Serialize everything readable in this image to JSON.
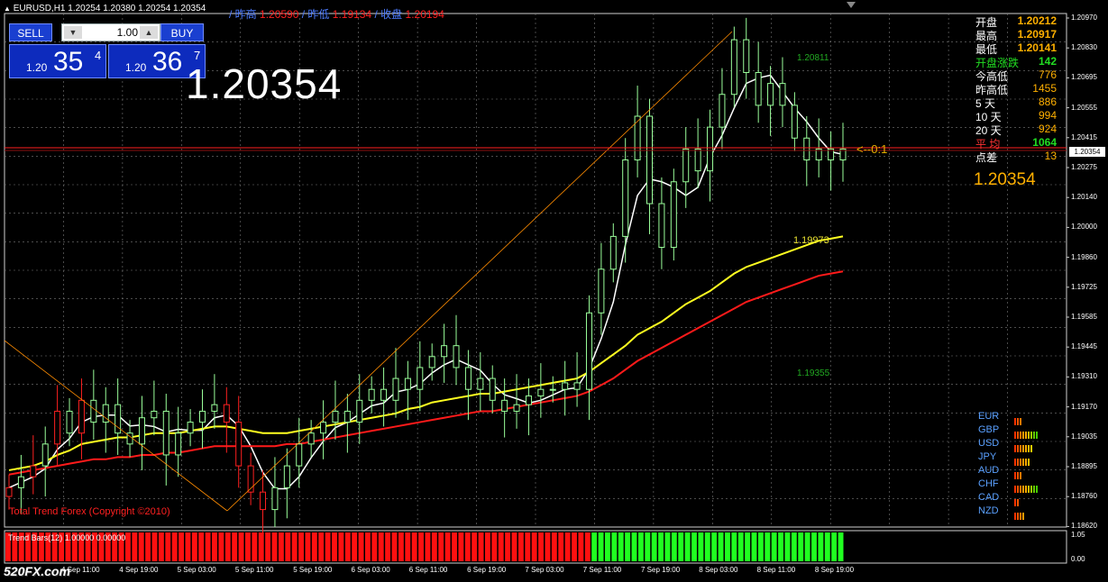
{
  "header": {
    "symbol_info": "EURUSD,H1  1.20254 1.20380 1.20254 1.20354",
    "prev_high_label": "/ 昨高",
    "prev_high_value": "1.20590",
    "prev_low_label": "/ 昨低",
    "prev_low_value": "1.19134",
    "prev_close_label": "/ 收盘",
    "prev_close_value": "1.20194"
  },
  "one_click": {
    "sell_label": "SELL",
    "buy_label": "BUY",
    "lot_value": "1.00",
    "sell_prefix": "1.20",
    "sell_big": "35",
    "sell_sup": "4",
    "buy_prefix": "1.20",
    "buy_big": "36",
    "buy_sup": "7"
  },
  "current_price_big": "1.20354",
  "stats": [
    {
      "label": "开盘",
      "value": "1.20212",
      "label_color": "#ffffff",
      "value_color": "#ffb000"
    },
    {
      "label": "最高",
      "value": "1.20917",
      "label_color": "#ffffff",
      "value_color": "#ffb000"
    },
    {
      "label": "最低",
      "value": "1.20141",
      "label_color": "#ffffff",
      "value_color": "#ffb000"
    },
    {
      "label": "开盘涨跌",
      "value": "142",
      "label_color": "#22dd22",
      "value_color": "#22dd22"
    },
    {
      "label": "今高低",
      "value": "776",
      "label_color": "#ffffff",
      "value_color": "#ffb000"
    },
    {
      "label": "昨高低",
      "value": "1455",
      "label_color": "#ffffff",
      "value_color": "#ffb000"
    },
    {
      "label": "5  天",
      "value": "886",
      "label_color": "#ffffff",
      "value_color": "#ffb000"
    },
    {
      "label": "10 天",
      "value": "994",
      "label_color": "#ffffff",
      "value_color": "#ffb000"
    },
    {
      "label": "20 天",
      "value": "924",
      "label_color": "#ffffff",
      "value_color": "#ffb000"
    },
    {
      "label": "平 均",
      "value": "1064",
      "label_color": "#ff3333",
      "value_color": "#22dd22"
    },
    {
      "label": "点差",
      "value": "13",
      "label_color": "#ffffff",
      "value_color": "#ffb000"
    }
  ],
  "stats_price": "1.20354",
  "arrow_label": "<--0:1",
  "labels": {
    "high_marker": "1.20811",
    "mid_marker": "1.19973",
    "low_marker": "1.19355",
    "copyright": "Total Trend Forex (Copyright ©2010)",
    "indicator_name": "Trend Bars(12) 1.00000 0.00000",
    "watermark": "520FX.com"
  },
  "price_axis": [
    "1.20970",
    "1.20830",
    "1.20695",
    "1.20555",
    "1.20415",
    "1.20275",
    "1.20140",
    "1.20000",
    "1.19860",
    "1.19725",
    "1.19585",
    "1.19445",
    "1.19310",
    "1.19170",
    "1.19035",
    "1.18895",
    "1.18760",
    "1.18620"
  ],
  "current_price_tag": "1.20354",
  "indicator_axis": [
    "1.05",
    "0.00"
  ],
  "time_axis": [
    "4 Sep 11:00",
    "4 Sep 19:00",
    "5 Sep 03:00",
    "5 Sep 11:00",
    "5 Sep 19:00",
    "6 Sep 03:00",
    "6 Sep 11:00",
    "6 Sep 19:00",
    "7 Sep 03:00",
    "7 Sep 11:00",
    "7 Sep 19:00",
    "8 Sep 03:00",
    "8 Sep 11:00",
    "8 Sep 19:00"
  ],
  "currencies": [
    {
      "name": "EUR",
      "bars": [
        "#ff3300",
        "#ff5500",
        "#ff7700"
      ]
    },
    {
      "name": "GBP",
      "bars": [
        "#ff3300",
        "#ff5500",
        "#ff7700",
        "#ff9900",
        "#ffaa00",
        "#ccbb00",
        "#99cc00",
        "#66cc00",
        "#44cc00"
      ]
    },
    {
      "name": "USD",
      "bars": [
        "#ff3300",
        "#ff5500",
        "#ff7700",
        "#ff9900",
        "#ffaa00",
        "#ffbb00",
        "#ffcc00"
      ]
    },
    {
      "name": "JPY",
      "bars": [
        "#ff3300",
        "#ff5500",
        "#ff7700",
        "#ff9900",
        "#ffaa00",
        "#ffbb00"
      ]
    },
    {
      "name": "AUD",
      "bars": [
        "#ff3300",
        "#ff5500",
        "#ff7700"
      ]
    },
    {
      "name": "CHF",
      "bars": [
        "#ff3300",
        "#ff5500",
        "#ff7700",
        "#ff9900",
        "#ffaa00",
        "#ccbb00",
        "#99cc00",
        "#66cc00",
        "#44cc00"
      ]
    },
    {
      "name": "CAD",
      "bars": [
        "#ff3300",
        "#ff5500"
      ]
    },
    {
      "name": "NZD",
      "bars": [
        "#ff3300",
        "#ff5500",
        "#ff7700",
        "#ff9900"
      ]
    }
  ],
  "chart_data": {
    "type": "candlestick",
    "symbol": "EURUSD",
    "timeframe": "H1",
    "ylim": [
      1.1862,
      1.2097
    ],
    "grid": true,
    "series": [
      {
        "name": "close",
        "values": [
          1.188,
          1.1885,
          1.189,
          1.19,
          1.1915,
          1.1905,
          1.192,
          1.191,
          1.1918,
          1.1905,
          1.19,
          1.1912,
          1.1915,
          1.1895,
          1.1905,
          1.191,
          1.1915,
          1.1918,
          1.191,
          1.189,
          1.1878,
          1.187,
          1.188,
          1.189,
          1.19,
          1.1905,
          1.191,
          1.1915,
          1.191,
          1.192,
          1.1925,
          1.192,
          1.193,
          1.1925,
          1.1935,
          1.194,
          1.1945,
          1.1935,
          1.1925,
          1.193,
          1.192,
          1.1915,
          1.1918,
          1.1922,
          1.1925,
          1.1925,
          1.1928,
          1.1925,
          1.196,
          1.198,
          1.1995,
          1.203,
          1.205,
          1.201,
          1.199,
          1.202,
          1.2035,
          1.2025,
          1.2045,
          1.206,
          1.2085,
          1.207,
          1.2055,
          1.2065,
          1.2055,
          1.204,
          1.203,
          1.2035,
          1.203,
          1.2035
        ]
      },
      {
        "name": "",
        "values": [
          1.1888,
          1.1889,
          1.189,
          1.1892,
          1.1895,
          1.1897,
          1.19,
          1.1901,
          1.1902,
          1.1903,
          1.1903,
          1.1904,
          1.1905,
          1.1905,
          1.1905,
          1.1906,
          1.1907,
          1.1908,
          1.1908,
          1.1907,
          1.1906,
          1.1905,
          1.1905,
          1.1905,
          1.1906,
          1.1907,
          1.1908,
          1.1909,
          1.191,
          1.1911,
          1.1912,
          1.1913,
          1.1914,
          1.1916,
          1.1917,
          1.1919,
          1.192,
          1.1921,
          1.1922,
          1.1923,
          1.1923,
          1.1924,
          1.1925,
          1.1926,
          1.1927,
          1.1928,
          1.1929,
          1.193,
          1.1933,
          1.1937,
          1.1941,
          1.1945,
          1.195,
          1.1953,
          1.1956,
          1.196,
          1.1964,
          1.1967,
          1.197,
          1.1974,
          1.1978,
          1.1981,
          1.1983,
          1.1985,
          1.1987,
          1.1989,
          1.1991,
          1.1993,
          1.1994,
          1.1995
        ]
      },
      {
        "name": "",
        "values": [
          1.1886,
          1.1887,
          1.1888,
          1.1889,
          1.189,
          1.1891,
          1.1892,
          1.1893,
          1.1893,
          1.1894,
          1.1894,
          1.1895,
          1.1895,
          1.1896,
          1.1896,
          1.1897,
          1.1898,
          1.1899,
          1.1899,
          1.1899,
          1.1899,
          1.1899,
          1.1899,
          1.19,
          1.19,
          1.1901,
          1.1902,
          1.1903,
          1.1904,
          1.1905,
          1.1906,
          1.1907,
          1.1908,
          1.1909,
          1.191,
          1.1911,
          1.1912,
          1.1913,
          1.1914,
          1.1915,
          1.1915,
          1.1916,
          1.1917,
          1.1918,
          1.1919,
          1.192,
          1.1921,
          1.1922,
          1.1924,
          1.1927,
          1.193,
          1.1934,
          1.1938,
          1.1941,
          1.1944,
          1.1947,
          1.195,
          1.1953,
          1.1956,
          1.1959,
          1.1962,
          1.1965,
          1.1967,
          1.1969,
          1.1971,
          1.1973,
          1.1975,
          1.1977,
          1.1978,
          1.1979
        ]
      }
    ],
    "trend_bars": {
      "red_count": 88,
      "green_count": 38
    }
  }
}
